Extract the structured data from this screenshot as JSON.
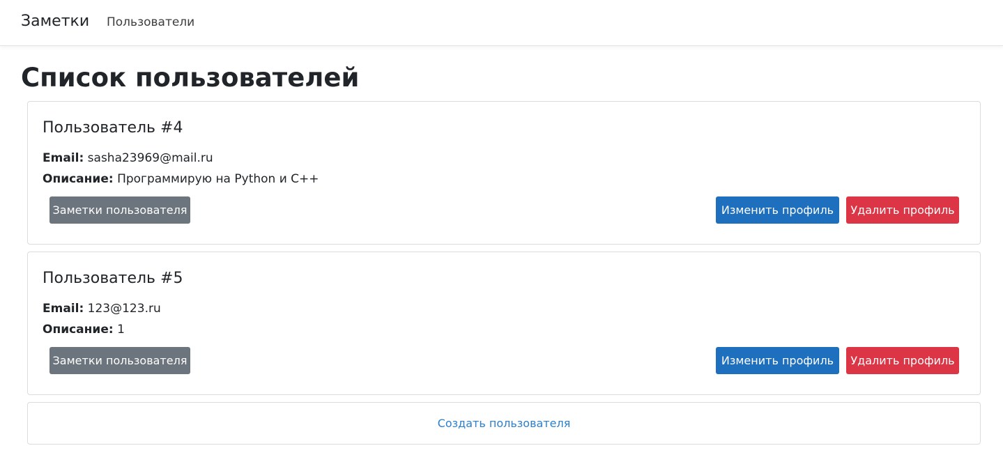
{
  "navbar": {
    "brand": "Заметки",
    "link_users": "Пользователи"
  },
  "page": {
    "title": "Список пользователей"
  },
  "labels": {
    "email": "Email:",
    "description": "Описание:"
  },
  "users": [
    {
      "title": "Пользователь #4",
      "email": "sasha23969@mail.ru",
      "description": "Программирую на Python и C++",
      "notes_button": "Заметки пользователя",
      "edit_button": "Изменить профиль",
      "delete_button": "Удалить профиль"
    },
    {
      "title": "Пользователь #5",
      "email": "123@123.ru",
      "description": "1",
      "notes_button": "Заметки пользователя",
      "edit_button": "Изменить профиль",
      "delete_button": "Удалить профиль"
    }
  ],
  "create_link": "Создать пользователя",
  "colors": {
    "secondary": "#6c757d",
    "primary": "#1f6fbf",
    "danger": "#dc3545",
    "link": "#2a7fd0"
  }
}
